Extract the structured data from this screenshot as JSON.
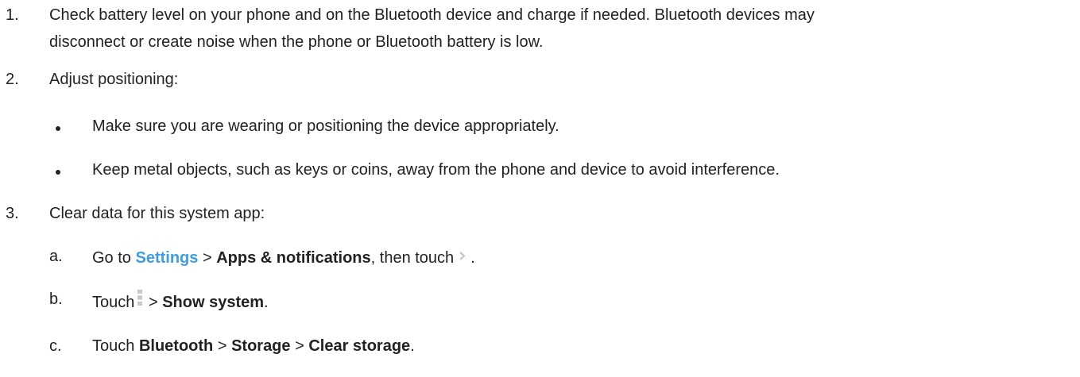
{
  "steps": [
    {
      "marker": "1.",
      "lines": [
        "Check battery level on your phone and on the Bluetooth device and charge if needed. Bluetooth devices may",
        "disconnect or create noise when the phone or Bluetooth battery is low."
      ]
    },
    {
      "marker": "2.",
      "text": "Adjust positioning:",
      "bullets": [
        "Make sure you are wearing or positioning the device appropriately.",
        "Keep metal objects, such as keys or coins, away from the phone and device to avoid interference."
      ]
    },
    {
      "marker": "3.",
      "text": "Clear data for this system app:",
      "substeps": [
        {
          "marker": "a.",
          "go_to": "Go to",
          "settings_link": "Settings",
          "sep1": ">",
          "apps": "Apps & notifications",
          "then_touch": ", then touch",
          "end": "."
        },
        {
          "marker": "b.",
          "touch": "Touch",
          "sep": ">",
          "show_system": "Show system",
          "end": "."
        },
        {
          "marker": "c.",
          "touch": "Touch",
          "bluetooth": "Bluetooth",
          "sep1": ">",
          "storage": "Storage",
          "sep2": ">",
          "clear_storage": "Clear storage",
          "end": "."
        }
      ]
    }
  ],
  "icons": {
    "chevron": "chevron-right-icon",
    "more": "more-vert-icon"
  },
  "colors": {
    "text": "#222222",
    "link": "#3d9be9",
    "icon": "#c8c8c8"
  }
}
